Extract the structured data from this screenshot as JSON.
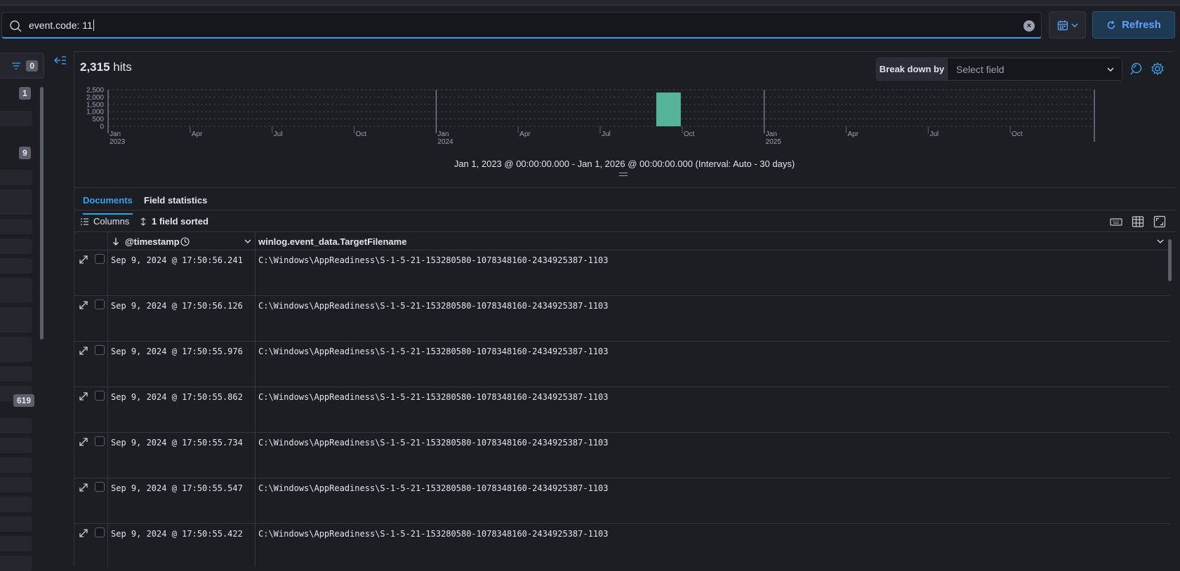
{
  "search": {
    "query": "event.code: 11"
  },
  "toolbar": {
    "refresh_label": "Refresh"
  },
  "sidebar": {
    "filter_count": "0",
    "badges": [
      "1",
      "9",
      "619"
    ]
  },
  "hits": {
    "count": "2,315",
    "label": "hits"
  },
  "breakdown": {
    "label": "Break down by",
    "placeholder": "Select field"
  },
  "chart_data": {
    "type": "bar",
    "x_ticks": [
      {
        "label": "Jan",
        "sub": "2023"
      },
      {
        "label": "Apr",
        "sub": ""
      },
      {
        "label": "Jul",
        "sub": ""
      },
      {
        "label": "Oct",
        "sub": ""
      },
      {
        "label": "Jan",
        "sub": "2024"
      },
      {
        "label": "Apr",
        "sub": ""
      },
      {
        "label": "Jul",
        "sub": ""
      },
      {
        "label": "Oct",
        "sub": ""
      },
      {
        "label": "Jan",
        "sub": "2025"
      },
      {
        "label": "Apr",
        "sub": ""
      },
      {
        "label": "Jul",
        "sub": ""
      },
      {
        "label": "Oct",
        "sub": ""
      }
    ],
    "y_ticks": [
      "2,500",
      "2,000",
      "1,500",
      "1,000",
      "500",
      "0"
    ],
    "ylim": [
      0,
      2500
    ],
    "bars": [
      {
        "period": "Sep 2024",
        "value": 2315
      }
    ],
    "grid": true,
    "color": "#54b399"
  },
  "time_range": "Jan 1, 2023 @ 00:00:00.000 - Jan 1, 2026 @ 00:00:00.000 (Interval: Auto - 30 days)",
  "tabs": [
    {
      "label": "Documents"
    },
    {
      "label": "Field statistics"
    }
  ],
  "grid_toolbar": {
    "columns_label": "Columns",
    "sorted_label": "1 field sorted"
  },
  "columns": {
    "timestamp": "@timestamp",
    "filename": "winlog.event_data.TargetFilename"
  },
  "rows": [
    {
      "ts": "Sep 9, 2024 @ 17:50:56.241",
      "fn": "C:\\Windows\\AppReadiness\\S-1-5-21-153280580-1078348160-2434925387-1103"
    },
    {
      "ts": "Sep 9, 2024 @ 17:50:56.126",
      "fn": "C:\\Windows\\AppReadiness\\S-1-5-21-153280580-1078348160-2434925387-1103"
    },
    {
      "ts": "Sep 9, 2024 @ 17:50:55.976",
      "fn": "C:\\Windows\\AppReadiness\\S-1-5-21-153280580-1078348160-2434925387-1103"
    },
    {
      "ts": "Sep 9, 2024 @ 17:50:55.862",
      "fn": "C:\\Windows\\AppReadiness\\S-1-5-21-153280580-1078348160-2434925387-1103"
    },
    {
      "ts": "Sep 9, 2024 @ 17:50:55.734",
      "fn": "C:\\Windows\\AppReadiness\\S-1-5-21-153280580-1078348160-2434925387-1103"
    },
    {
      "ts": "Sep 9, 2024 @ 17:50:55.547",
      "fn": "C:\\Windows\\AppReadiness\\S-1-5-21-153280580-1078348160-2434925387-1103"
    },
    {
      "ts": "Sep 9, 2024 @ 17:50:55.422",
      "fn": "C:\\Windows\\AppReadiness\\S-1-5-21-153280580-1078348160-2434925387-1103"
    }
  ]
}
